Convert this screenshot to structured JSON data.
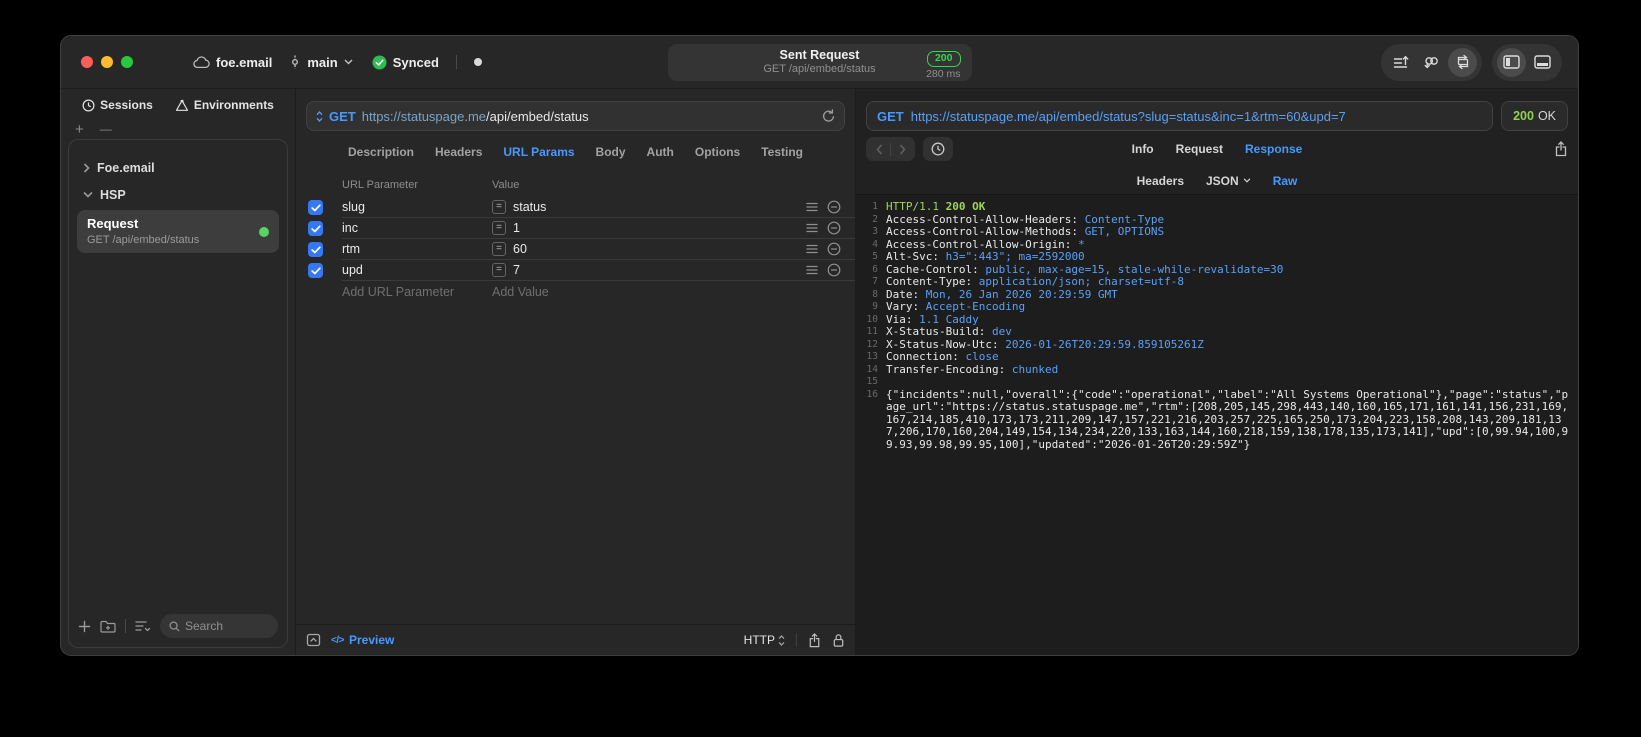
{
  "colors": {
    "accent": "#4799ff",
    "green": "#32d74b",
    "code_green": "#9fd54f",
    "code_blue": "#58a0f8",
    "cb_blue": "#3478f6",
    "host_blue": "#7aa3c9"
  },
  "titlebar": {
    "project": "foe.email",
    "branch": "main",
    "sync_status": "Synced",
    "request_title": "Sent Request",
    "request_subtitle": "GET /api/embed/status",
    "status_code": "200",
    "duration": "280 ms"
  },
  "sidebar": {
    "tabs": [
      {
        "label": "Sessions"
      },
      {
        "label": "Environments"
      }
    ],
    "add_label": "+",
    "remove_label": "—",
    "groups": [
      {
        "label": "Foe.email"
      },
      {
        "label": "HSP"
      }
    ],
    "request_item": {
      "title": "Request",
      "subtitle": "GET /api/embed/status"
    },
    "search_placeholder": "Search"
  },
  "request_pane": {
    "method": "GET",
    "url_host": "https://statuspage.me",
    "url_path": "/api/embed/status",
    "tabs": [
      "Description",
      "Headers",
      "URL Params",
      "Body",
      "Auth",
      "Options",
      "Testing"
    ],
    "active_tab": "URL Params",
    "table": {
      "param_header": "URL Parameter",
      "value_header": "Value",
      "equals_glyph": "=",
      "rows": [
        {
          "name": "slug",
          "value": "status",
          "enabled": true
        },
        {
          "name": "inc",
          "value": "1",
          "enabled": true
        },
        {
          "name": "rtm",
          "value": "60",
          "enabled": true
        },
        {
          "name": "upd",
          "value": "7",
          "enabled": true
        }
      ],
      "add_param_label": "Add URL Parameter",
      "add_value_label": "Add Value"
    },
    "footer": {
      "code_glyph": "</>",
      "preview_label": "Preview",
      "protocol_label": "HTTP"
    }
  },
  "response_pane": {
    "method": "GET",
    "url": "https://statuspage.me/api/embed/status?slug=status&inc=1&rtm=60&upd=7",
    "status_code": "200",
    "status_text": "OK",
    "tabs": [
      "Info",
      "Request",
      "Response"
    ],
    "active_tab": "Response",
    "subtabs": [
      "Headers",
      "JSON",
      "Raw"
    ],
    "active_subtab": "Raw",
    "code": {
      "lines": [
        {
          "n": "1",
          "parts": [
            {
              "t": "HTTP/1.1 ",
              "c": "green"
            },
            {
              "t": "200 OK",
              "c": "greenb"
            }
          ]
        },
        {
          "n": "2",
          "parts": [
            {
              "t": "Access-Control-Allow-Headers: ",
              "c": "plain"
            },
            {
              "t": "Content-Type",
              "c": "blue"
            }
          ]
        },
        {
          "n": "3",
          "parts": [
            {
              "t": "Access-Control-Allow-Methods: ",
              "c": "plain"
            },
            {
              "t": "GET, OPTIONS",
              "c": "blue"
            }
          ]
        },
        {
          "n": "4",
          "parts": [
            {
              "t": "Access-Control-Allow-Origin: ",
              "c": "plain"
            },
            {
              "t": "*",
              "c": "blue"
            }
          ]
        },
        {
          "n": "5",
          "parts": [
            {
              "t": "Alt-Svc: ",
              "c": "plain"
            },
            {
              "t": "h3=\":443\"; ma=2592000",
              "c": "blue"
            }
          ]
        },
        {
          "n": "6",
          "parts": [
            {
              "t": "Cache-Control: ",
              "c": "plain"
            },
            {
              "t": "public, max-age=15, stale-while-revalidate=30",
              "c": "blue"
            }
          ]
        },
        {
          "n": "7",
          "parts": [
            {
              "t": "Content-Type: ",
              "c": "plain"
            },
            {
              "t": "application/json; charset=utf-8",
              "c": "blue"
            }
          ]
        },
        {
          "n": "8",
          "parts": [
            {
              "t": "Date: ",
              "c": "plain"
            },
            {
              "t": "Mon, 26 Jan 2026 20:29:59 GMT",
              "c": "blue"
            }
          ]
        },
        {
          "n": "9",
          "parts": [
            {
              "t": "Vary: ",
              "c": "plain"
            },
            {
              "t": "Accept-Encoding",
              "c": "blue"
            }
          ]
        },
        {
          "n": "10",
          "parts": [
            {
              "t": "Via: ",
              "c": "plain"
            },
            {
              "t": "1.1 Caddy",
              "c": "blue"
            }
          ]
        },
        {
          "n": "11",
          "parts": [
            {
              "t": "X-Status-Build: ",
              "c": "plain"
            },
            {
              "t": "dev",
              "c": "blue"
            }
          ]
        },
        {
          "n": "12",
          "parts": [
            {
              "t": "X-Status-Now-Utc: ",
              "c": "plain"
            },
            {
              "t": "2026-01-26T20:29:59.859105261Z",
              "c": "blue"
            }
          ]
        },
        {
          "n": "13",
          "parts": [
            {
              "t": "Connection: ",
              "c": "plain"
            },
            {
              "t": "close",
              "c": "blue"
            }
          ]
        },
        {
          "n": "14",
          "parts": [
            {
              "t": "Transfer-Encoding: ",
              "c": "plain"
            },
            {
              "t": "chunked",
              "c": "blue"
            }
          ]
        },
        {
          "n": "15",
          "parts": []
        },
        {
          "n": "16",
          "parts": [
            {
              "t": "{\"incidents\":null,\"overall\":{\"code\":\"operational\",\"label\":\"All Systems Operational\"},\"page\":\"status\",\"page_url\":\"https://status.statuspage.me\",\"rtm\":[208,205,145,298,443,140,160,165,171,161,141,156,231,169,167,214,185,410,173,173,211,209,147,157,221,216,203,257,225,165,250,173,204,223,158,208,143,209,181,137,206,170,160,204,149,154,134,234,220,133,163,144,160,218,159,138,178,135,173,141],\"upd\":[0,99.94,100,99.93,99.98,99.95,100],\"updated\":\"2026-01-26T20:29:59Z\"}",
              "c": "plain"
            }
          ]
        }
      ]
    }
  }
}
